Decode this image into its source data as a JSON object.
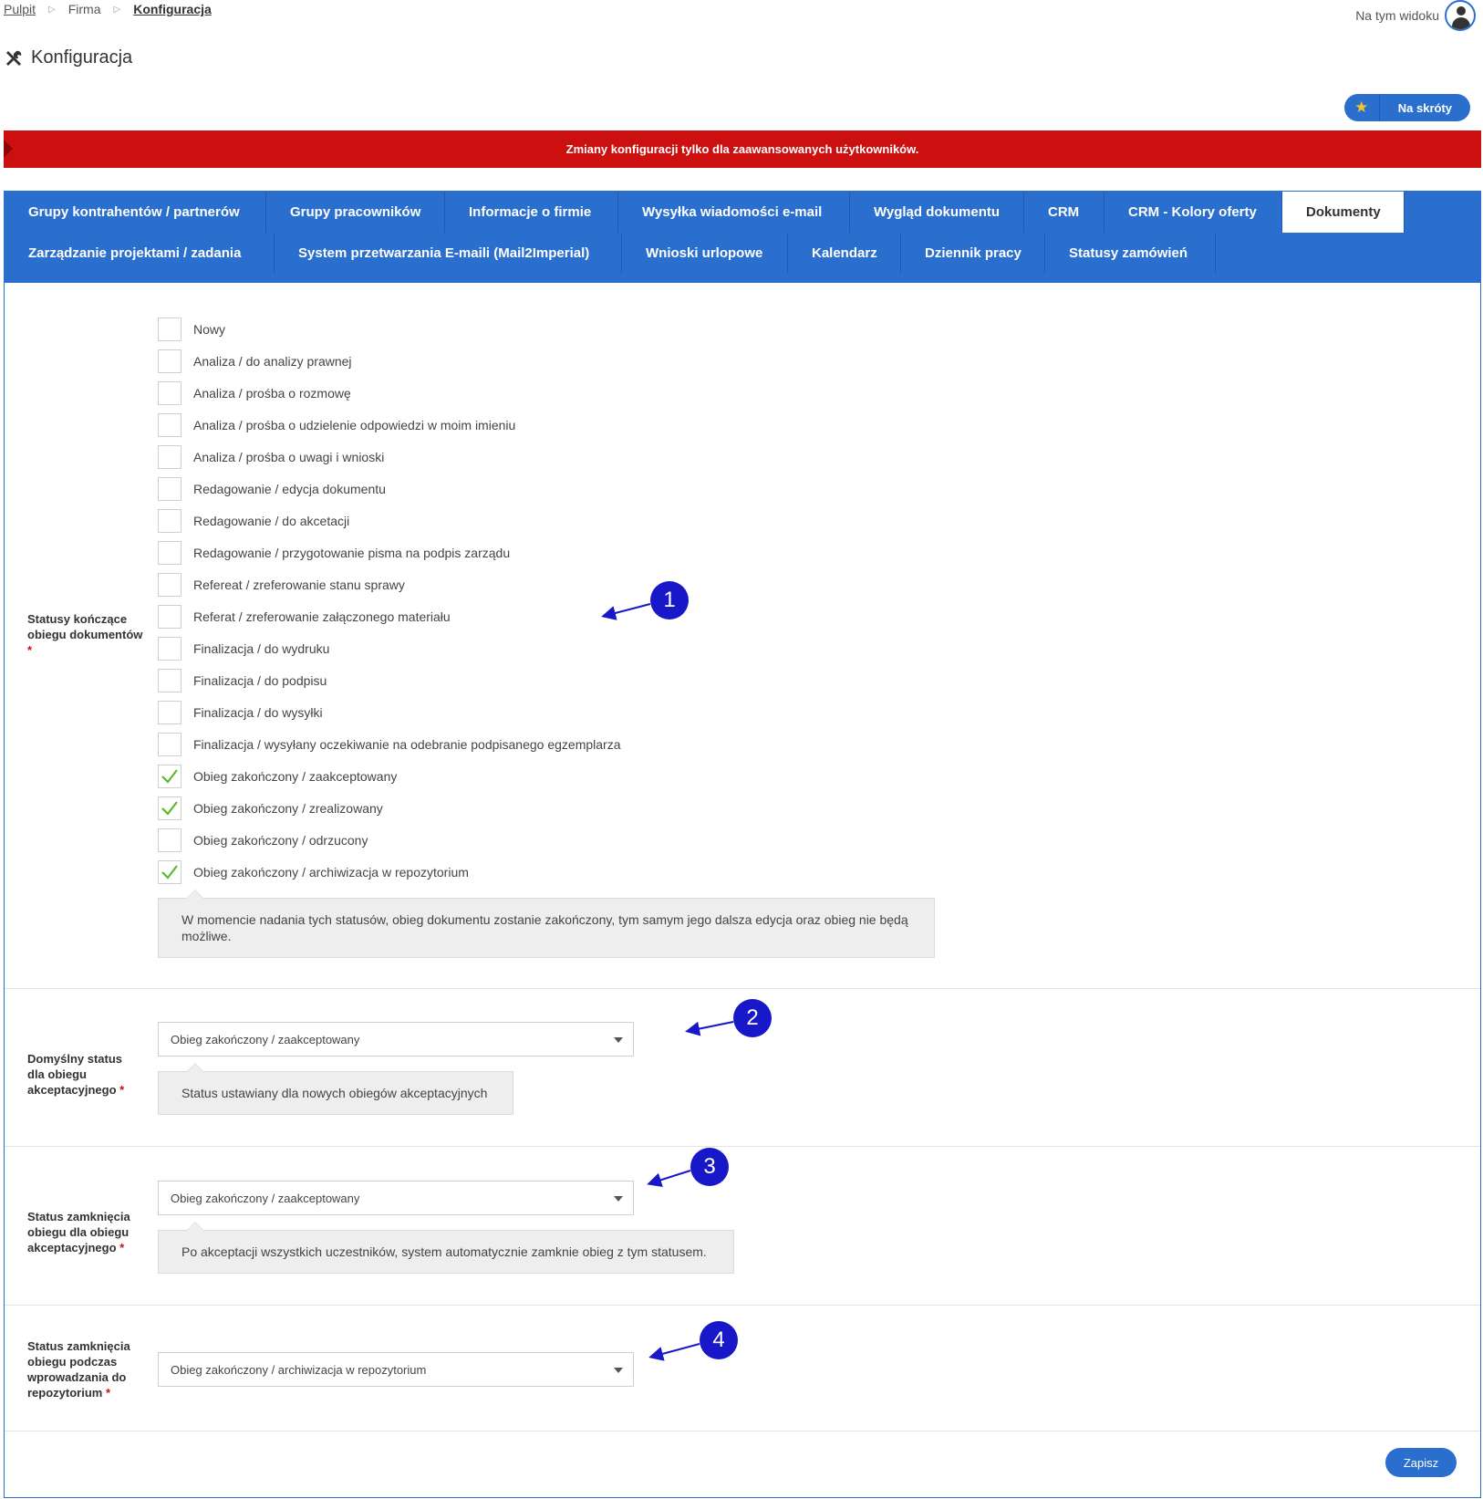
{
  "breadcrumb": {
    "items": [
      "Pulpit",
      "Firma",
      "Konfiguracja"
    ]
  },
  "user_area": {
    "label": "Na tym widoku"
  },
  "page": {
    "title": "Konfiguracja"
  },
  "shortcuts": {
    "label": "Na skróty"
  },
  "alert": {
    "text": "Zmiany konfiguracji tylko dla zaawansowanych użytkowników."
  },
  "tabs": {
    "items": [
      "Grupy kontrahentów / partnerów",
      "Grupy pracowników",
      "Informacje o firmie",
      "Wysyłka wiadomości e-mail",
      "Wygląd dokumentu",
      "CRM",
      "CRM - Kolory oferty",
      "Dokumenty",
      "Zarządzanie projektami / zadania",
      "System przetwarzania E-maili (Mail2Imperial)",
      "Wnioski urlopowe",
      "Kalendarz",
      "Dziennik pracy",
      "Statusy zamówień"
    ],
    "active": "Dokumenty"
  },
  "end_statuses": {
    "label_lines": [
      "Statusy kończące",
      "obiegu dokumentów"
    ],
    "required": "*",
    "items": [
      {
        "label": "Nowy",
        "checked": false
      },
      {
        "label": "Analiza / do analizy prawnej",
        "checked": false
      },
      {
        "label": "Analiza / prośba o rozmowę",
        "checked": false
      },
      {
        "label": "Analiza / prośba o udzielenie odpowiedzi w moim imieniu",
        "checked": false
      },
      {
        "label": "Analiza / prośba o uwagi i wnioski",
        "checked": false
      },
      {
        "label": "Redagowanie / edycja dokumentu",
        "checked": false
      },
      {
        "label": "Redagowanie / do akcetacji",
        "checked": false
      },
      {
        "label": "Redagowanie / przygotowanie pisma na podpis zarządu",
        "checked": false
      },
      {
        "label": "Refereat / zreferowanie stanu sprawy",
        "checked": false
      },
      {
        "label": "Referat / zreferowanie załączonego materiału",
        "checked": false
      },
      {
        "label": "Finalizacja / do wydruku",
        "checked": false
      },
      {
        "label": "Finalizacja / do podpisu",
        "checked": false
      },
      {
        "label": "Finalizacja / do wysyłki",
        "checked": false
      },
      {
        "label": "Finalizacja / wysyłany oczekiwanie na odebranie podpisanego egzemplarza",
        "checked": false
      },
      {
        "label": "Obieg zakończony / zaakceptowany",
        "checked": true
      },
      {
        "label": "Obieg zakończony / zrealizowany",
        "checked": true
      },
      {
        "label": "Obieg zakończony / odrzucony",
        "checked": false
      },
      {
        "label": "Obieg zakończony / archiwizacja w repozytorium",
        "checked": true
      }
    ],
    "hint": "W momencie nadania tych statusów, obieg dokumentu zostanie zakończony, tym samym jego dalsza edycja oraz obieg nie będą możliwe."
  },
  "default_status": {
    "label_lines": [
      "Domyślny status",
      "dla obiegu",
      "akceptacyjnego"
    ],
    "required": "*",
    "value": "Obieg zakończony / zaakceptowany",
    "hint": "Status ustawiany dla nowych obiegów akceptacyjnych"
  },
  "close_status": {
    "label_lines": [
      "Status zamknięcia",
      "obiegu dla obiegu",
      "akceptacyjnego"
    ],
    "required": "*",
    "value": "Obieg zakończony / zaakceptowany",
    "hint": "Po akceptacji wszystkich uczestników, system automatycznie zamknie obieg z tym statusem."
  },
  "repo_close_status": {
    "label_lines": [
      "Status zamknięcia",
      "obiegu podczas",
      "wprowadzania do",
      "repozytorium"
    ],
    "required": "*",
    "value": "Obieg zakończony / archiwizacja w repozytorium"
  },
  "annotations": [
    "1",
    "2",
    "3",
    "4"
  ],
  "actions": {
    "save_label": "Zapisz"
  },
  "colors": {
    "primary": "#2a6fce",
    "alert": "#cc1010",
    "annotation": "#1818c8",
    "check": "#5cb82e"
  },
  "icons": [
    "tools-icon",
    "user-icon",
    "star-icon",
    "check-icon",
    "chevron-down-icon"
  ]
}
